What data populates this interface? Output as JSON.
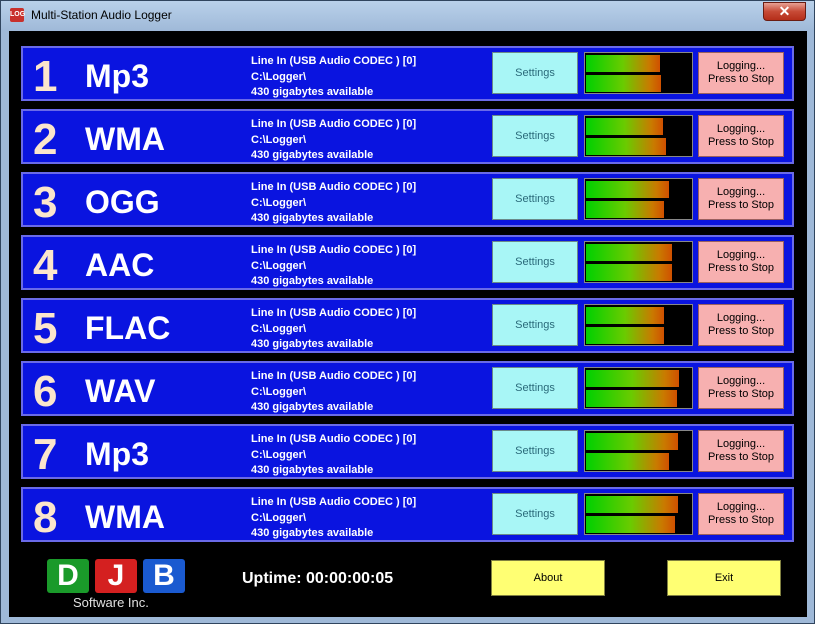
{
  "window": {
    "title": "Multi-Station Audio Logger",
    "icon_text": "LOG",
    "close_label": "✕"
  },
  "stations": [
    {
      "number": "1",
      "format": "Mp3",
      "device": "Line In (USB Audio CODEC ) [0]",
      "path": "C:\\Logger\\",
      "space": "430 gigabytes available",
      "settings_label": "Settings",
      "logging_line1": "Logging...",
      "logging_line2": "Press to Stop",
      "level_left": 0.7,
      "level_right": 0.71
    },
    {
      "number": "2",
      "format": "WMA",
      "device": "Line In (USB Audio CODEC ) [0]",
      "path": "C:\\Logger\\",
      "space": "430 gigabytes available",
      "settings_label": "Settings",
      "logging_line1": "Logging...",
      "logging_line2": "Press to Stop",
      "level_left": 0.73,
      "level_right": 0.75
    },
    {
      "number": "3",
      "format": "OGG",
      "device": "Line In (USB Audio CODEC ) [0]",
      "path": "C:\\Logger\\",
      "space": "430 gigabytes available",
      "settings_label": "Settings",
      "logging_line1": "Logging...",
      "logging_line2": "Press to Stop",
      "level_left": 0.78,
      "level_right": 0.74
    },
    {
      "number": "4",
      "format": "AAC",
      "device": "Line In (USB Audio CODEC ) [0]",
      "path": "C:\\Logger\\",
      "space": "430 gigabytes available",
      "settings_label": "Settings",
      "logging_line1": "Logging...",
      "logging_line2": "Press to Stop",
      "level_left": 0.81,
      "level_right": 0.81
    },
    {
      "number": "5",
      "format": "FLAC",
      "device": "Line In (USB Audio CODEC ) [0]",
      "path": "C:\\Logger\\",
      "space": "430 gigabytes available",
      "settings_label": "Settings",
      "logging_line1": "Logging...",
      "logging_line2": "Press to Stop",
      "level_left": 0.74,
      "level_right": 0.74
    },
    {
      "number": "6",
      "format": "WAV",
      "device": "Line In (USB Audio CODEC ) [0]",
      "path": "C:\\Logger\\",
      "space": "430 gigabytes available",
      "settings_label": "Settings",
      "logging_line1": "Logging...",
      "logging_line2": "Press to Stop",
      "level_left": 0.88,
      "level_right": 0.86
    },
    {
      "number": "7",
      "format": "Mp3",
      "device": "Line In (USB Audio CODEC ) [0]",
      "path": "C:\\Logger\\",
      "space": "430 gigabytes available",
      "settings_label": "Settings",
      "logging_line1": "Logging...",
      "logging_line2": "Press to Stop",
      "level_left": 0.87,
      "level_right": 0.78
    },
    {
      "number": "8",
      "format": "WMA",
      "device": "Line In (USB Audio CODEC ) [0]",
      "path": "C:\\Logger\\",
      "space": "430 gigabytes available",
      "settings_label": "Settings",
      "logging_line1": "Logging...",
      "logging_line2": "Press to Stop",
      "level_left": 0.87,
      "level_right": 0.84
    }
  ],
  "footer": {
    "logo_letters": [
      "D",
      "J",
      "B"
    ],
    "logo_colors": [
      "#1a9a2a",
      "#d42020",
      "#1a5ad0"
    ],
    "logo_subtitle": "Software Inc.",
    "uptime": "Uptime: 00:00:00:05",
    "about_label": "About",
    "exit_label": "Exit"
  }
}
